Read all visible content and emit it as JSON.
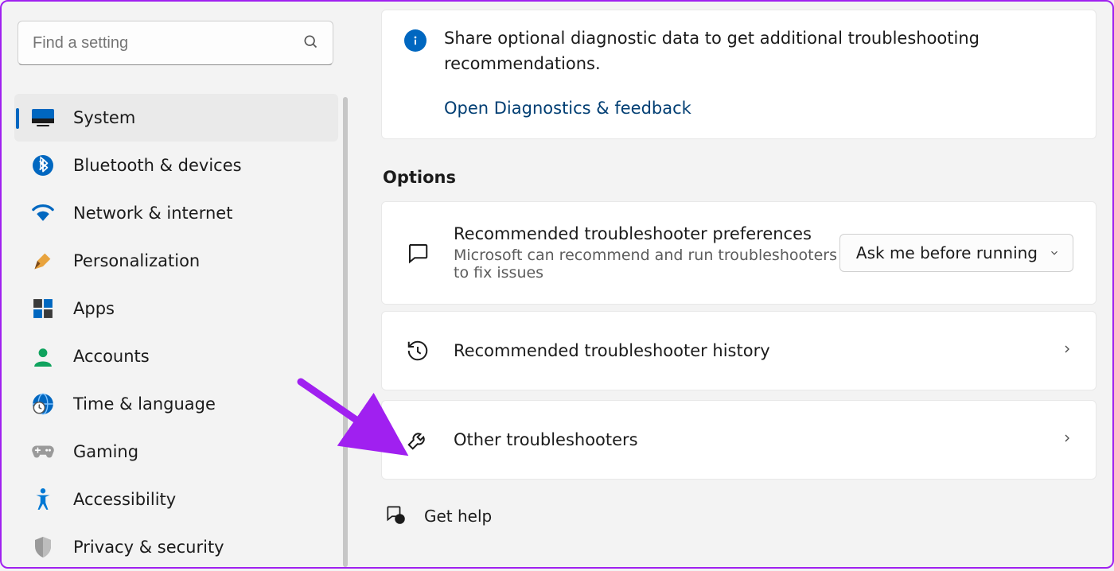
{
  "search": {
    "placeholder": "Find a setting"
  },
  "sidebar": {
    "items": [
      {
        "label": "System",
        "icon": "system",
        "selected": true
      },
      {
        "label": "Bluetooth & devices",
        "icon": "bluetooth",
        "selected": false
      },
      {
        "label": "Network & internet",
        "icon": "wifi",
        "selected": false
      },
      {
        "label": "Personalization",
        "icon": "personalization",
        "selected": false
      },
      {
        "label": "Apps",
        "icon": "apps",
        "selected": false
      },
      {
        "label": "Accounts",
        "icon": "accounts",
        "selected": false
      },
      {
        "label": "Time & language",
        "icon": "time-language",
        "selected": false
      },
      {
        "label": "Gaming",
        "icon": "gaming",
        "selected": false
      },
      {
        "label": "Accessibility",
        "icon": "accessibility",
        "selected": false
      },
      {
        "label": "Privacy & security",
        "icon": "privacy",
        "selected": false
      }
    ]
  },
  "main": {
    "info": {
      "text": "Share optional diagnostic data to get additional troubleshooting recommendations.",
      "link": "Open Diagnostics & feedback"
    },
    "options_heading": "Options",
    "pref_card": {
      "title": "Recommended troubleshooter preferences",
      "desc": "Microsoft can recommend and run troubleshooters to fix issues",
      "dropdown_value": "Ask me before running"
    },
    "history_card": {
      "title": "Recommended troubleshooter history"
    },
    "other_card": {
      "title": "Other troubleshooters"
    },
    "help_link": "Get help"
  },
  "icon_colors": {
    "system": "#0067c0",
    "bluetooth": "#0067c0",
    "wifi": "#0067c0",
    "accounts": "#0ba35e",
    "time-language": "#0067c0",
    "accessibility": "#0078d4",
    "privacy": "#8a8a8a"
  }
}
